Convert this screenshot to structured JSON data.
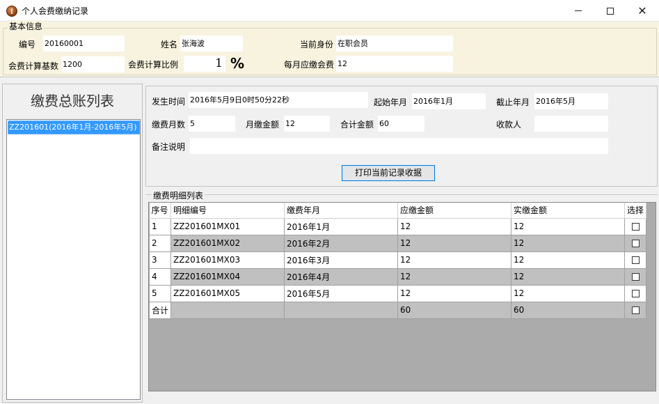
{
  "window": {
    "title": "个人会费缴纳记录"
  },
  "basic_info": {
    "group_title": "基本信息",
    "id_label": "编号",
    "id_value": "20160001",
    "name_label": "姓名",
    "name_value": "张海波",
    "status_label": "当前身份",
    "status_value": "在职会员",
    "base_label": "会费计算基数",
    "base_value": "1200",
    "ratio_label": "会费计算比例",
    "ratio_value": "1",
    "ratio_unit": "%",
    "monthly_label": "每月应缴会费",
    "monthly_value": "12"
  },
  "ledger": {
    "title": "缴费总账列表",
    "items": [
      "ZZ201601(2016年1月-2016年5月)"
    ]
  },
  "detail": {
    "time_label": "发生时间",
    "time_value": "2016年5月9日0时50分22秒",
    "start_label": "起始年月",
    "start_value": "2016年1月",
    "end_label": "截止年月",
    "end_value": "2016年5月",
    "months_label": "缴费月数",
    "months_value": "5",
    "monthly_label": "月缴金额",
    "monthly_value": "12",
    "total_label": "合计金额",
    "total_value": "60",
    "payee_label": "收款人",
    "payee_value": "",
    "note_label": "备注说明",
    "note_value": "",
    "print_button": "打印当前记录收据"
  },
  "details_grid": {
    "caption": "缴费明细列表",
    "columns": [
      "序号",
      "明细编号",
      "缴费年月",
      "应缴金额",
      "实缴金额",
      "选择"
    ],
    "rows": [
      {
        "idx": "1",
        "code": "ZZ201601MX01",
        "month": "2016年1月",
        "due": "12",
        "paid": "12"
      },
      {
        "idx": "2",
        "code": "ZZ201601MX02",
        "month": "2016年2月",
        "due": "12",
        "paid": "12"
      },
      {
        "idx": "3",
        "code": "ZZ201601MX03",
        "month": "2016年3月",
        "due": "12",
        "paid": "12"
      },
      {
        "idx": "4",
        "code": "ZZ201601MX04",
        "month": "2016年4月",
        "due": "12",
        "paid": "12"
      },
      {
        "idx": "5",
        "code": "ZZ201601MX05",
        "month": "2016年5月",
        "due": "12",
        "paid": "12"
      }
    ],
    "total_row": {
      "label": "合计",
      "due": "60",
      "paid": "60"
    }
  }
}
